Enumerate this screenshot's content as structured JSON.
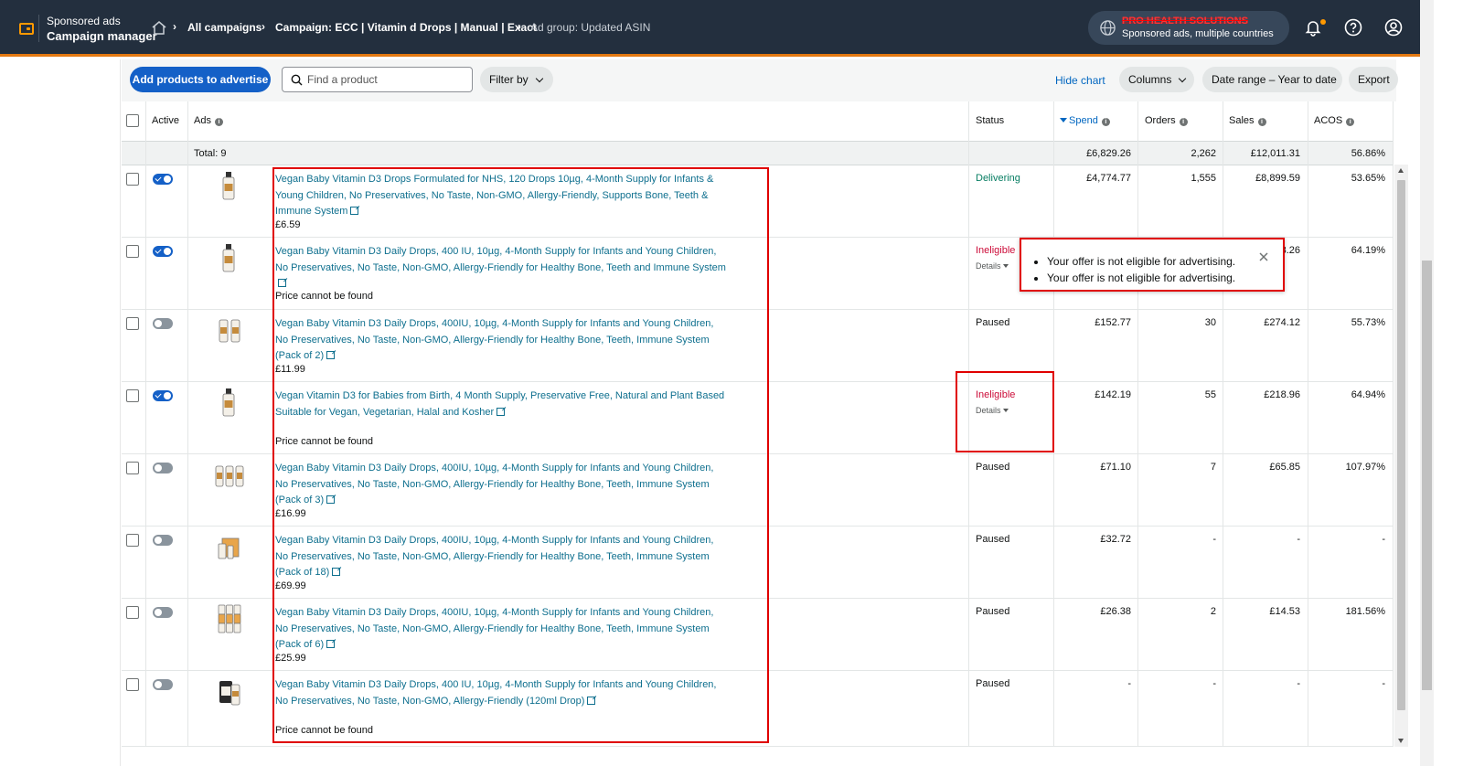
{
  "header": {
    "brand_sub": "Sponsored ads",
    "brand_main": "Campaign manager",
    "breadcrumbs": [
      {
        "label": "All campaigns"
      },
      {
        "label": "Campaign: ECC | Vitamin d Drops | Manual | Exact"
      },
      {
        "label": "Ad group: Updated ASIN"
      }
    ],
    "account_name": "PRO HEALTH SOLUTIONS",
    "account_sub": "Sponsored ads, multiple countries"
  },
  "toolbar": {
    "add_button": "Add products to advertise",
    "search_placeholder": "Find a product",
    "filter_button": "Filter by",
    "hide_chart": "Hide chart",
    "columns_button": "Columns",
    "date_range_button": "Date range – Year to date",
    "export_button": "Export"
  },
  "table": {
    "columns": {
      "active": "Active",
      "ads": "Ads",
      "status": "Status",
      "spend": "Spend",
      "orders": "Orders",
      "sales": "Sales",
      "acos": "ACOS"
    },
    "totals": {
      "label": "Total: 9",
      "spend": "£6,829.26",
      "orders": "2,262",
      "sales": "£12,011.31",
      "acos": "56.86%"
    },
    "rows": [
      {
        "title": "Vegan Baby Vitamin D3 Drops Formulated for NHS, 120 Drops 10µg, 4-Month Supply for Infants & Young Children, No Preservatives, No Taste, Non-GMO, Allergy-Friendly, Supports Bone, Teeth & Immune System",
        "price": "£6.59",
        "status": "Delivering",
        "details": "",
        "spend": "£4,774.77",
        "orders": "1,555",
        "sales": "£8,899.59",
        "acos": "53.65%"
      },
      {
        "title": "Vegan Baby Vitamin D3 Daily Drops, 400 IU, 10µg, 4-Month Supply for Infants and Young Children, No Preservatives, No Taste, Non-GMO, Allergy-Friendly for Healthy Bone, Teeth and Immune System",
        "price": "Price cannot be found",
        "status": "Ineligible",
        "details": "Details",
        "spend": "",
        "orders": "",
        "sales": "3.26",
        "acos": "64.19%"
      },
      {
        "title": "Vegan Baby Vitamin D3 Daily Drops, 400IU, 10µg, 4-Month Supply for Infants and Young Children, No Preservatives, No Taste, Non-GMO, Allergy-Friendly for Healthy Bone, Teeth, Immune System (Pack of 2)",
        "price": "£11.99",
        "status": "Paused",
        "details": "",
        "spend": "£152.77",
        "orders": "30",
        "sales": "£274.12",
        "acos": "55.73%"
      },
      {
        "title": "Vegan Vitamin D3 for Babies from Birth, 4 Month Supply, Preservative Free, Natural and Plant Based Suitable for Vegan, Vegetarian, Halal and Kosher",
        "price": "Price cannot be found",
        "status": "Ineligible",
        "details": "Details",
        "spend": "£142.19",
        "orders": "55",
        "sales": "£218.96",
        "acos": "64.94%"
      },
      {
        "title": "Vegan Baby Vitamin D3 Daily Drops, 400IU, 10µg, 4-Month Supply for Infants and Young Children, No Preservatives, No Taste, Non-GMO, Allergy-Friendly for Healthy Bone, Teeth, Immune System (Pack of 3)",
        "price": "£16.99",
        "status": "Paused",
        "details": "",
        "spend": "£71.10",
        "orders": "7",
        "sales": "£65.85",
        "acos": "107.97%"
      },
      {
        "title": "Vegan Baby Vitamin D3 Daily Drops, 400IU, 10µg, 4-Month Supply for Infants and Young Children, No Preservatives, No Taste, Non-GMO, Allergy-Friendly for Healthy Bone, Teeth, Immune System (Pack of 18)",
        "price": "£69.99",
        "status": "Paused",
        "details": "",
        "spend": "£32.72",
        "orders": "-",
        "sales": "-",
        "acos": "-"
      },
      {
        "title": "Vegan Baby Vitamin D3 Daily Drops, 400IU, 10µg, 4-Month Supply for Infants and Young Children, No Preservatives, No Taste, Non-GMO, Allergy-Friendly for Healthy Bone, Teeth, Immune System (Pack of 6)",
        "price": "£25.99",
        "status": "Paused",
        "details": "",
        "spend": "£26.38",
        "orders": "2",
        "sales": "£14.53",
        "acos": "181.56%"
      },
      {
        "title": "Vegan Baby Vitamin D3 Daily Drops, 400 IU, 10µg, 4-Month Supply for Infants and Young Children, No Preservatives, No Taste, Non-GMO, Allergy-Friendly (120ml Drop)",
        "price": "Price cannot be found",
        "status": "Paused",
        "details": "",
        "spend": "-",
        "orders": "-",
        "sales": "-",
        "acos": "-"
      }
    ]
  },
  "popover": {
    "messages": [
      "Your offer is not eligible for advertising.",
      "Your offer is not eligible for advertising."
    ]
  },
  "colors": {
    "header_bg": "#232f3e",
    "accent_orange": "#ff9900",
    "primary_button": "#1460c7",
    "link": "#0e6f8e",
    "delivering": "#067d62",
    "ineligible": "#cc0c39",
    "highlight_red": "#e00000"
  }
}
